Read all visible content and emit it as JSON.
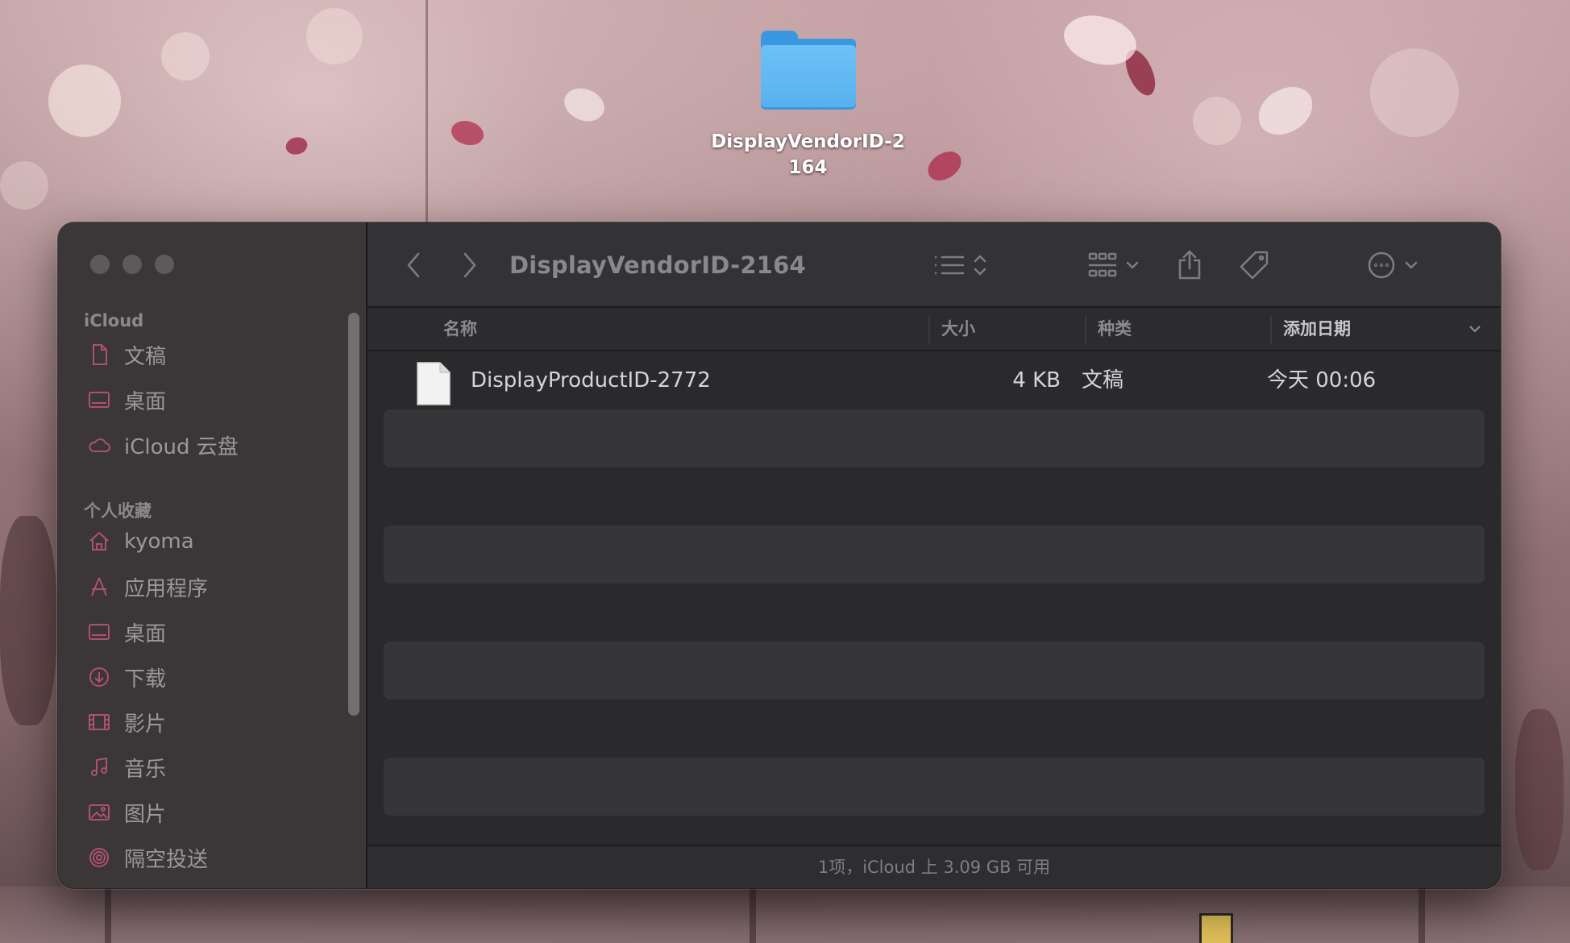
{
  "desktop": {
    "folder_label": "DisplayVendorID-2164"
  },
  "window": {
    "title": "DisplayVendorID-2164",
    "sidebar": {
      "sections": [
        {
          "title": "iCloud",
          "items": [
            {
              "label": "文稿",
              "icon": "document-icon"
            },
            {
              "label": "桌面",
              "icon": "desktop-icon"
            },
            {
              "label": "iCloud 云盘",
              "icon": "cloud-icon"
            }
          ]
        },
        {
          "title": "个人收藏",
          "items": [
            {
              "label": "kyoma",
              "icon": "home-icon"
            },
            {
              "label": "应用程序",
              "icon": "applications-icon"
            },
            {
              "label": "桌面",
              "icon": "desktop-icon"
            },
            {
              "label": "下载",
              "icon": "download-icon"
            },
            {
              "label": "影片",
              "icon": "film-icon"
            },
            {
              "label": "音乐",
              "icon": "music-icon"
            },
            {
              "label": "图片",
              "icon": "photo-icon"
            },
            {
              "label": "隔空投送",
              "icon": "airdrop-icon"
            }
          ]
        }
      ]
    },
    "columns": {
      "name": "名称",
      "size": "大小",
      "kind": "种类",
      "date_added": "添加日期"
    },
    "files": [
      {
        "name": "DisplayProductID-2772",
        "size": "4 KB",
        "kind": "文稿",
        "date_added": "今天 00:06"
      }
    ],
    "status": "1项，iCloud 上 3.09 GB 可用",
    "colors": {
      "accent_icon": "#b05070",
      "folder_blue": "#57b1ef"
    }
  }
}
